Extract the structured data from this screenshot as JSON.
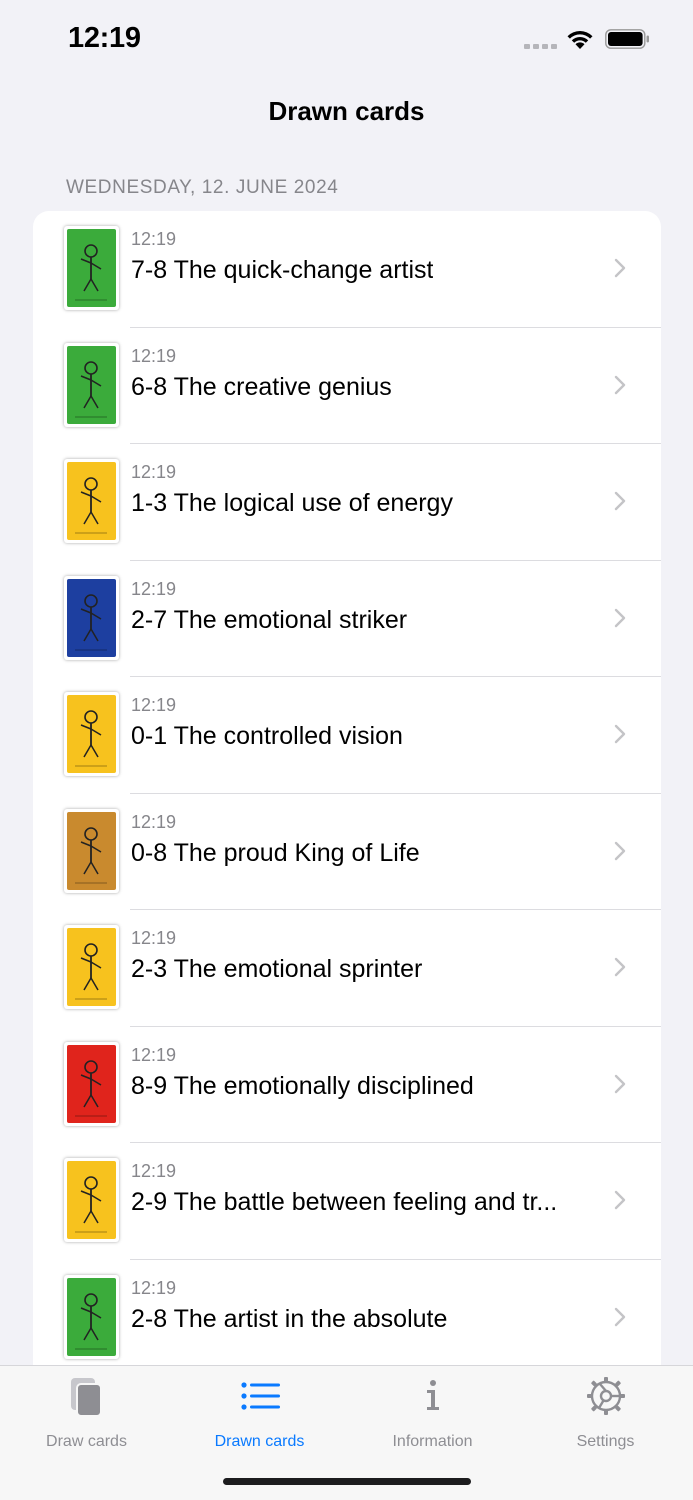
{
  "status_bar": {
    "time": "12:19"
  },
  "nav": {
    "title": "Drawn cards"
  },
  "section": {
    "header": "WEDNESDAY, 12. JUNE 2024"
  },
  "rows": [
    {
      "time": "12:19",
      "title": "7-8 The quick-change artist",
      "card_color": "#3bab3b"
    },
    {
      "time": "12:19",
      "title": "6-8 The creative genius",
      "card_color": "#3bab3b"
    },
    {
      "time": "12:19",
      "title": "1-3 The logical use of energy",
      "card_color": "#f7c21e"
    },
    {
      "time": "12:19",
      "title": "2-7 The emotional striker",
      "card_color": "#1d3fa0"
    },
    {
      "time": "12:19",
      "title": "0-1 The controlled vision",
      "card_color": "#f7c21e"
    },
    {
      "time": "12:19",
      "title": "0-8 The proud King of Life",
      "card_color": "#c98a2e"
    },
    {
      "time": "12:19",
      "title": "2-3 The emotional sprinter",
      "card_color": "#f7c21e"
    },
    {
      "time": "12:19",
      "title": "8-9 The emotionally disciplined",
      "card_color": "#e0241c"
    },
    {
      "time": "12:19",
      "title": "2-9 The battle between feeling and tr...",
      "card_color": "#f7c21e"
    },
    {
      "time": "12:19",
      "title": "2-8 The artist in the absolute",
      "card_color": "#3bab3b"
    }
  ],
  "tabs": [
    {
      "label": "Draw cards",
      "icon": "cards-icon",
      "active": false
    },
    {
      "label": "Drawn cards",
      "icon": "list-icon",
      "active": true
    },
    {
      "label": "Information",
      "icon": "info-icon",
      "active": false
    },
    {
      "label": "Settings",
      "icon": "gear-icon",
      "active": false
    }
  ],
  "colors": {
    "accent": "#0a7aff",
    "inactive_tab": "#8e8e93",
    "background": "#f2f2f7"
  }
}
